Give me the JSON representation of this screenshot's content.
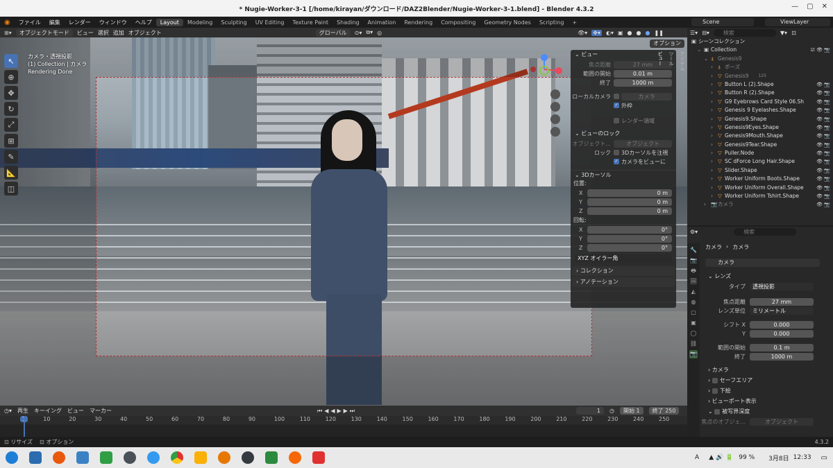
{
  "window": {
    "title": "* Nugie-Worker-3-1 [/home/kirayan/ダウンロード/DAZ2Blender/Nugie-Worker-3-1.blend] - Blender 4.3.2"
  },
  "menu": [
    "ファイル",
    "編集",
    "レンダー",
    "ウィンドウ",
    "ヘルプ"
  ],
  "workspaces": [
    "Layout",
    "Modeling",
    "Sculpting",
    "UV Editing",
    "Texture Paint",
    "Shading",
    "Animation",
    "Rendering",
    "Compositing",
    "Geometry Nodes",
    "Scripting",
    "+"
  ],
  "scene": {
    "name": "Scene",
    "view_layer": "ViewLayer"
  },
  "viewport_header": {
    "mode": "オブジェクトモード",
    "items": [
      "ビュー",
      "選択",
      "追加",
      "オブジェクト"
    ],
    "transform": "グローバル",
    "options": "オプション"
  },
  "viewport_info": {
    "line1": "カメラ・透視投影",
    "line2": "(1) Collection | カメラ",
    "line3": "Rendering Done"
  },
  "npanel": {
    "view_header": "ビュー",
    "focal_label": "焦点距離",
    "focal": "27 mm",
    "clip_start_label": "範囲の開始",
    "clip_start": "0.01 m",
    "clip_end_label": "終了",
    "clip_end": "1000 m",
    "local_camera_label": "ローカルカメラ",
    "local_camera": "カメラ",
    "outline": "外枠",
    "render_region": "レンダー領域",
    "view_lock_header": "ビューのロック",
    "object_label": "オブジェクト...",
    "object": "オブジェクト",
    "lock_label": "ロック",
    "lock_3d_cursor": "3Dカーソルを注視",
    "camera_to_view": "カメラをビューに",
    "cursor_header": "3Dカーソル",
    "location_label": "位置:",
    "loc_x": "0 m",
    "loc_y": "0 m",
    "loc_z": "0 m",
    "rotation_label": "回転:",
    "rot_x": "0°",
    "rot_y": "0°",
    "rot_z": "0°",
    "x": "X",
    "y": "Y",
    "z": "Z",
    "euler": "XYZ オイラー角",
    "collection_header": "コレクション",
    "annotation_header": "アノテーション"
  },
  "side_tabs": [
    "アイテム",
    "ツール",
    "ビュー"
  ],
  "outliner": {
    "search_placeholder": "検索",
    "root": "シーンコレクション",
    "rows": [
      {
        "label": "Collection"
      },
      {
        "label": "Genesis9"
      },
      {
        "label": "ポーズ"
      },
      {
        "label": "Genesis9"
      },
      {
        "label": "Button L (2).Shape"
      },
      {
        "label": "Button R (2).Shape"
      },
      {
        "label": "G9 Eyebrows Card Style 06.Sh"
      },
      {
        "label": "Genesis 9 Eyelashes.Shape"
      },
      {
        "label": "Genesis9.Shape"
      },
      {
        "label": "Genesis9Eyes.Shape"
      },
      {
        "label": "Genesis9Mouth.Shape"
      },
      {
        "label": "Genesis9Tear.Shape"
      },
      {
        "label": "Puller.Node"
      },
      {
        "label": "SC dForce Long Hair.Shape"
      },
      {
        "label": "Slider.Shape"
      },
      {
        "label": "Worker Uniform Boots.Shape"
      },
      {
        "label": "Worker Uniform Overall.Shape"
      },
      {
        "label": "Worker Uniform Tshirt.Shape"
      },
      {
        "label": "カメラ"
      }
    ],
    "modifier_count": "125"
  },
  "properties": {
    "search_placeholder": "検索",
    "breadcrumb_obj": "カメラ",
    "breadcrumb_data": "カメラ",
    "datablock": "カメラ",
    "lens_header": "レンズ",
    "type_label": "タイプ",
    "type": "透視投影",
    "focal_label": "焦点距離",
    "focal": "27 mm",
    "unit_label": "レンズ単位",
    "unit": "ミリメートル",
    "shift_x_label": "シフト X",
    "shift_x": "0.000",
    "shift_y_label": "Y",
    "shift_y": "0.000",
    "clip_start_label": "範囲の開始",
    "clip_start": "0.1 m",
    "clip_end_label": "終了",
    "clip_end": "1000 m",
    "sections": [
      "カメラ",
      "セーフエリア",
      "下絵",
      "ビューポート表示",
      "被写界深度"
    ],
    "focus_obj_label": "焦点のオブジェ...",
    "focus_obj": "オブジェクト"
  },
  "timeline": {
    "menus": [
      "再生",
      "キーイング",
      "ビュー",
      "マーカー"
    ],
    "current_frame": "1",
    "start_label": "開始",
    "start": "1",
    "end_label": "終了",
    "end": "250",
    "ticks": [
      "1",
      "10",
      "20",
      "30",
      "40",
      "50",
      "60",
      "70",
      "80",
      "90",
      "100",
      "110",
      "120",
      "130",
      "140",
      "150",
      "160",
      "170",
      "180",
      "190",
      "200",
      "210",
      "220",
      "230",
      "240",
      "250"
    ]
  },
  "statusbar": {
    "left1": "リサイズ",
    "left2": "オプション",
    "version": "4.3.2"
  },
  "taskbar": {
    "battery": "99 %",
    "input": "A",
    "date": "3月8日",
    "time": "12:33"
  }
}
